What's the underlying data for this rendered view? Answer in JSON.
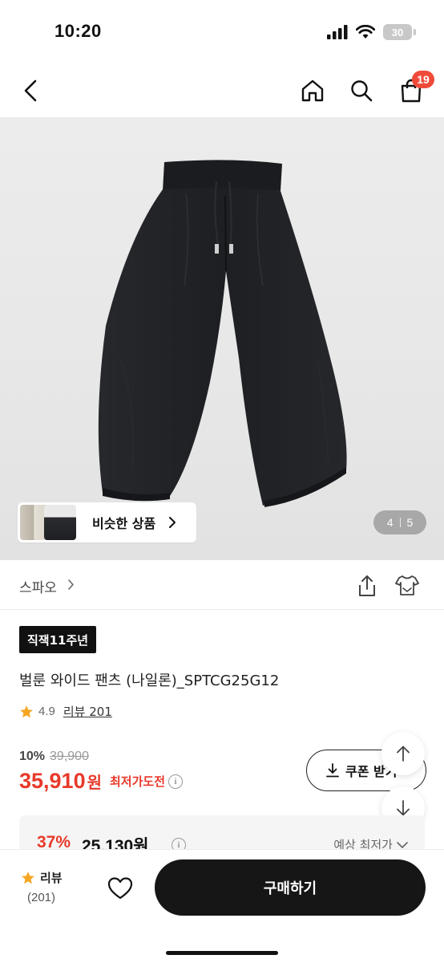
{
  "status_bar": {
    "time": "10:20",
    "battery": "30"
  },
  "nav": {
    "cart_count": "19"
  },
  "image": {
    "similar_label": "비슷한 상품",
    "page_current": "4",
    "page_total": "5"
  },
  "brand": {
    "name": "스파오"
  },
  "product": {
    "tag": "직잭11주년",
    "name": "벌룬 와이드 팬츠 (나일론)_SPTCG25G12",
    "rating": "4.9",
    "review_link": "리뷰 201",
    "discount": "10%",
    "original_price": "39,900",
    "price": "35,910",
    "price_unit": "원",
    "lowest_label": "최저가도전",
    "coupon_label": "쿠폰 받기"
  },
  "best_price": {
    "percent": "37%",
    "price": "25,130원",
    "label": "예상 최저가"
  },
  "bottom": {
    "review_label": "리뷰",
    "review_count": "(201)",
    "buy_label": "구매하기"
  },
  "colors": {
    "accent_red": "#e8392a",
    "badge_red": "#f04b3a",
    "star": "#f5a623",
    "buy_button": "#161616"
  }
}
